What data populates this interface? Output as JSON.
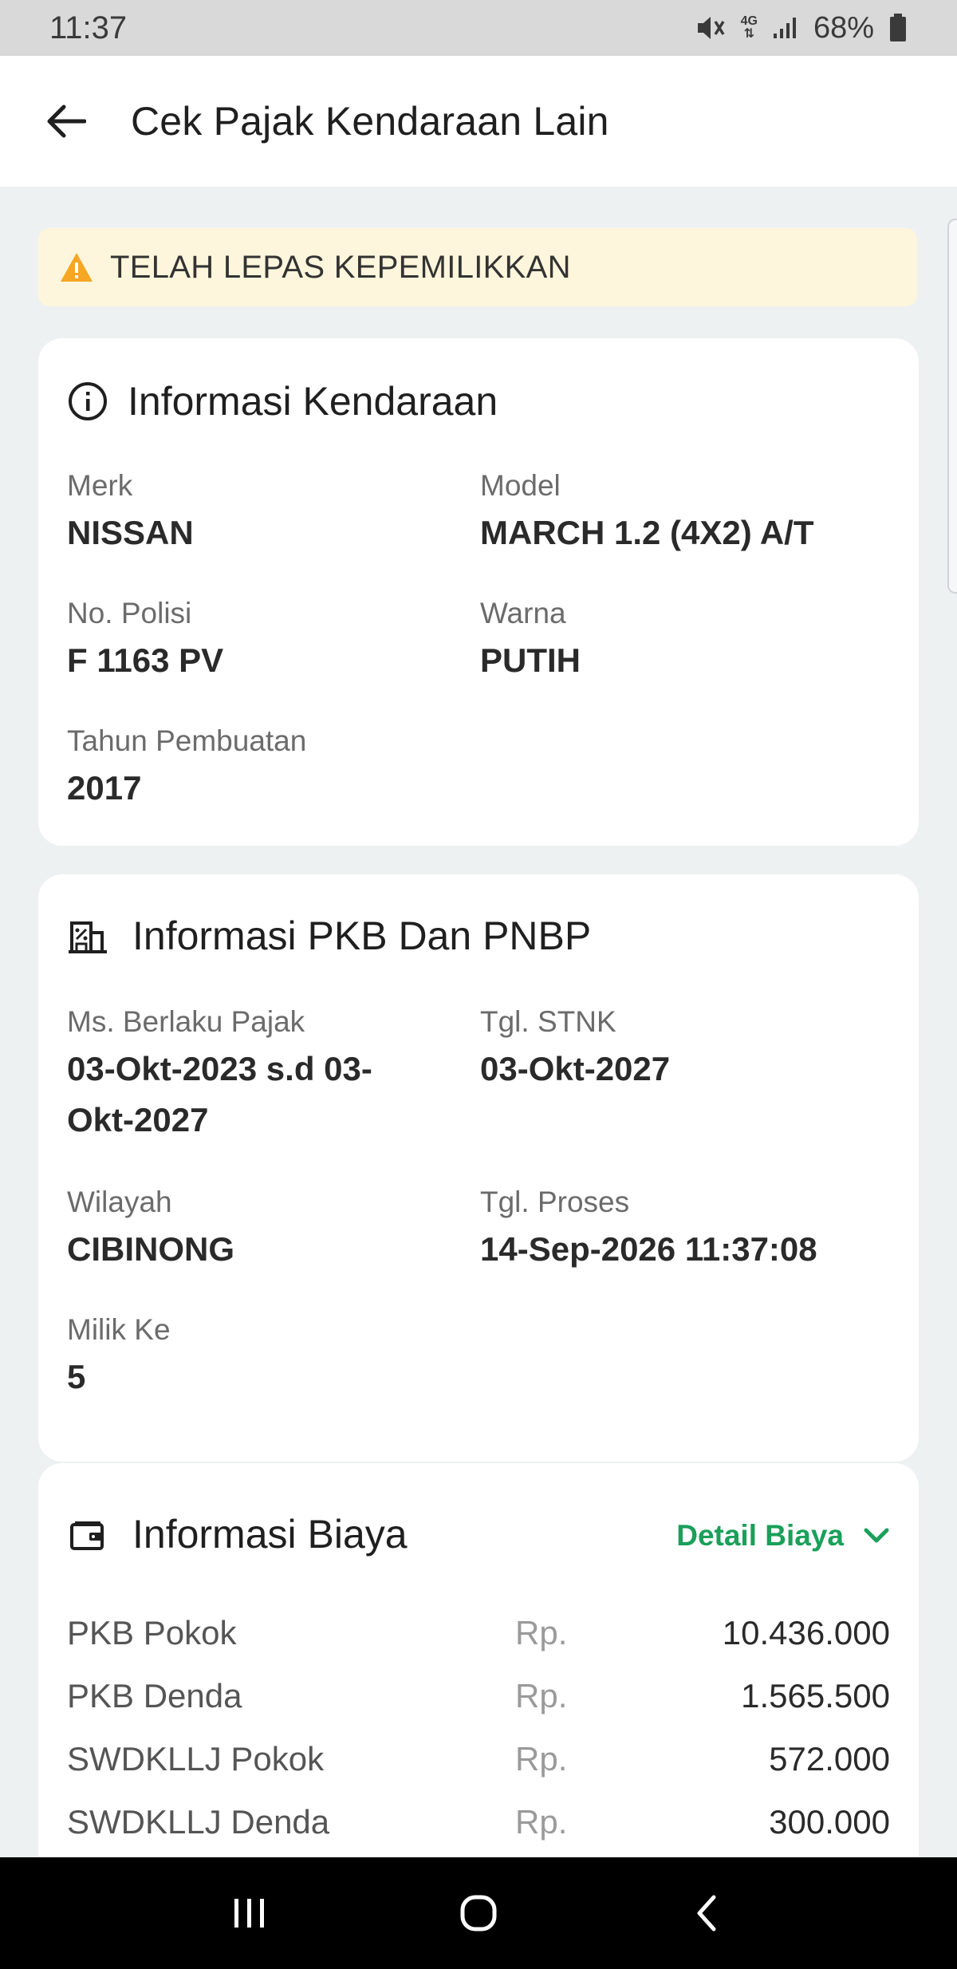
{
  "status_bar": {
    "time": "11:37",
    "network": "4G",
    "battery": "68%"
  },
  "header": {
    "title": "Cek Pajak Kendaraan Lain"
  },
  "warning": {
    "text": "TELAH LEPAS KEPEMILIKKAN",
    "color": "#f5a623"
  },
  "vehicle_info": {
    "title": "Informasi Kendaraan",
    "merk_label": "Merk",
    "merk_value": "NISSAN",
    "model_label": "Model",
    "model_value": "MARCH 1.2 (4X2) A/T",
    "polisi_label": "No. Polisi",
    "polisi_value": "F 1163 PV",
    "warna_label": "Warna",
    "warna_value": "PUTIH",
    "tahun_label": "Tahun Pembuatan",
    "tahun_value": "2017"
  },
  "pkb_info": {
    "title": "Informasi PKB Dan PNBP",
    "ms_label": "Ms. Berlaku Pajak",
    "ms_value_line1": "03-Okt-2023 s.d 03-",
    "ms_value_line2": "Okt-2027",
    "stnk_label": "Tgl. STNK",
    "stnk_value": "03-Okt-2027",
    "wilayah_label": "Wilayah",
    "wilayah_value": "CIBINONG",
    "proses_label": "Tgl. Proses",
    "proses_value": "14-Sep-2026 11:37:08",
    "milik_label": "Milik Ke",
    "milik_value": "5"
  },
  "cost_info": {
    "title": "Informasi Biaya",
    "detail_label": "Detail Biaya",
    "accent_color": "#1aa05a",
    "rows": [
      {
        "label": "PKB Pokok",
        "currency": "Rp.",
        "value": "10.436.000"
      },
      {
        "label": "PKB Denda",
        "currency": "Rp.",
        "value": "1.565.500"
      },
      {
        "label": "SWDKLLJ Pokok",
        "currency": "Rp.",
        "value": "572.000"
      },
      {
        "label": "SWDKLLJ Denda",
        "currency": "Rp.",
        "value": "300.000"
      }
    ]
  }
}
